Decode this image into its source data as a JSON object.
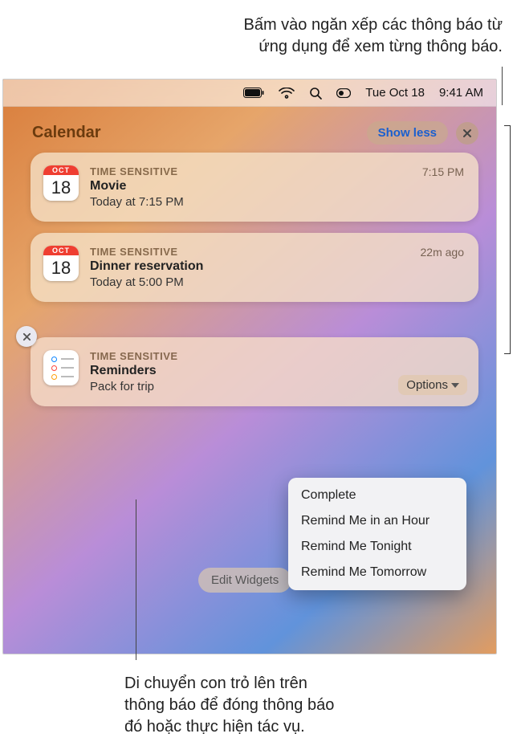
{
  "captions": {
    "top_line1": "Bấm vào ngăn xếp các thông báo từ",
    "top_line2": "ứng dụng để xem từng thông báo.",
    "bottom_line1": "Di chuyển con trỏ lên trên",
    "bottom_line2": "thông báo để đóng thông báo",
    "bottom_line3": "đó hoặc thực hiện tác vụ."
  },
  "menubar": {
    "date": "Tue Oct 18",
    "time": "9:41 AM"
  },
  "group": {
    "app_title": "Calendar",
    "show_less": "Show less"
  },
  "calendar_icon": {
    "month": "OCT",
    "day": "18"
  },
  "notifications": [
    {
      "ts": "TIME SENSITIVE",
      "title": "Movie",
      "sub": "Today at 7:15 PM",
      "time": "7:15 PM"
    },
    {
      "ts": "TIME SENSITIVE",
      "title": "Dinner reservation",
      "sub": "Today at 5:00 PM",
      "time": "22m ago"
    }
  ],
  "reminder": {
    "ts": "TIME SENSITIVE",
    "title": "Reminders",
    "sub": "Pack for trip",
    "options_label": "Options"
  },
  "dropdown": {
    "items": [
      "Complete",
      "Remind Me in an Hour",
      "Remind Me Tonight",
      "Remind Me Tomorrow"
    ]
  },
  "edit_widgets": "Edit Widgets"
}
